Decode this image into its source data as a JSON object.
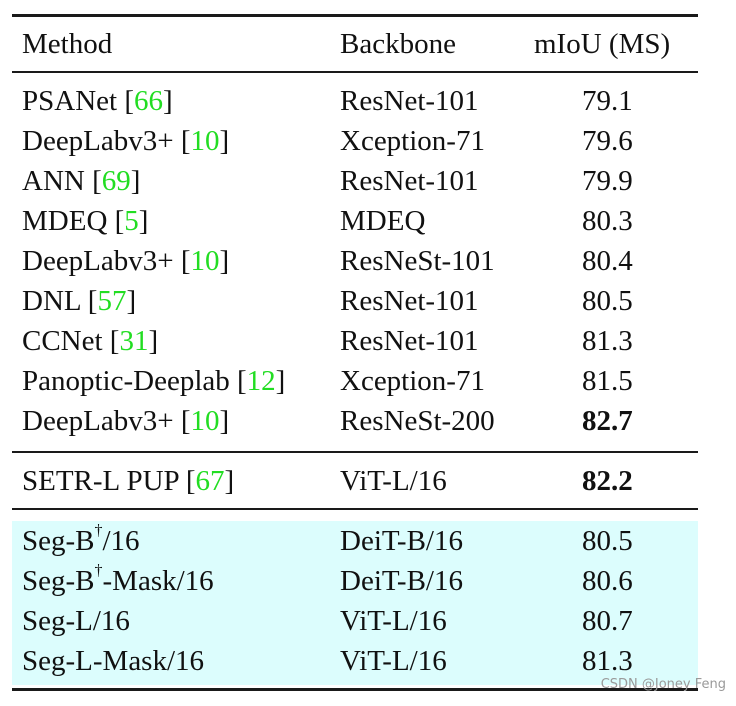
{
  "table": {
    "headers": {
      "method": "Method",
      "backbone": "Backbone",
      "miou": "mIoU (MS)"
    },
    "group1": [
      {
        "method": "PSANet",
        "cite": "66",
        "backbone": "ResNet-101",
        "miou": "79.1",
        "bold": false
      },
      {
        "method": "DeepLabv3+",
        "cite": "10",
        "backbone": "Xception-71",
        "miou": "79.6",
        "bold": false
      },
      {
        "method": "ANN",
        "cite": "69",
        "backbone": "ResNet-101",
        "miou": "79.9",
        "bold": false
      },
      {
        "method": "MDEQ",
        "cite": "5",
        "backbone": "MDEQ",
        "miou": "80.3",
        "bold": false
      },
      {
        "method": "DeepLabv3+",
        "cite": "10",
        "backbone": "ResNeSt-101",
        "miou": "80.4",
        "bold": false
      },
      {
        "method": "DNL",
        "cite": "57",
        "backbone": "ResNet-101",
        "miou": "80.5",
        "bold": false
      },
      {
        "method": "CCNet",
        "cite": "31",
        "backbone": "ResNet-101",
        "miou": "81.3",
        "bold": false
      },
      {
        "method": "Panoptic-Deeplab",
        "cite": "12",
        "backbone": "Xception-71",
        "miou": "81.5",
        "bold": false
      },
      {
        "method": "DeepLabv3+",
        "cite": "10",
        "backbone": "ResNeSt-200",
        "miou": "82.7",
        "bold": true
      }
    ],
    "group2": [
      {
        "method": "SETR-L PUP",
        "cite": "67",
        "backbone": "ViT-L/16",
        "miou": "82.2",
        "bold": true
      }
    ],
    "group3": [
      {
        "method_pre": "Seg-B",
        "sup": "†",
        "method_post": "/16",
        "backbone": "DeiT-B/16",
        "miou": "80.5"
      },
      {
        "method_pre": "Seg-B",
        "sup": "†",
        "method_post": "-Mask/16",
        "backbone": "DeiT-B/16",
        "miou": "80.6"
      },
      {
        "method_pre": "Seg-L/16",
        "sup": "",
        "method_post": "",
        "backbone": "ViT-L/16",
        "miou": "80.7"
      },
      {
        "method_pre": "Seg-L-Mask/16",
        "sup": "",
        "method_post": "",
        "backbone": "ViT-L/16",
        "miou": "81.3"
      }
    ],
    "highlight_color": "#dcfdfd",
    "citation_color": "#22dd22"
  },
  "watermark": "CSDN @Joney Feng"
}
